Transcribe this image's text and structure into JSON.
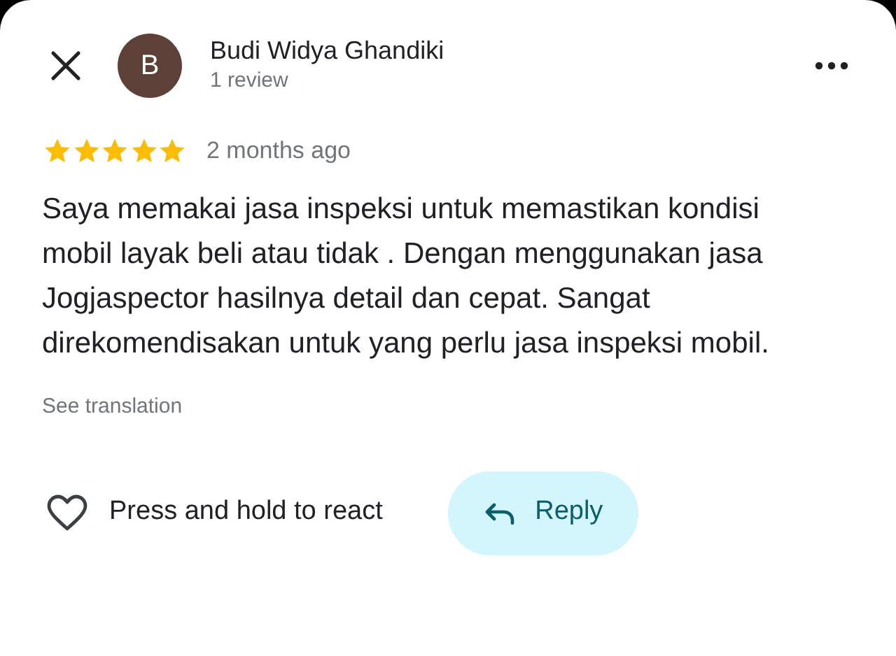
{
  "reviewer": {
    "initial": "B",
    "name": "Budi Widya Ghandiki",
    "subtitle": "1 review"
  },
  "rating": {
    "stars": 5,
    "time": "2 months ago"
  },
  "review_text": "Saya memakai jasa inspeksi untuk memastikan kondisi mobil layak beli atau tidak . Dengan menggunakan jasa Jogjaspector hasilnya detail dan cepat. Sangat direkomendisakan untuk yang perlu jasa inspeksi mobil.",
  "translation_link": "See translation",
  "react_label": "Press and hold to react",
  "reply_button": "Reply"
}
